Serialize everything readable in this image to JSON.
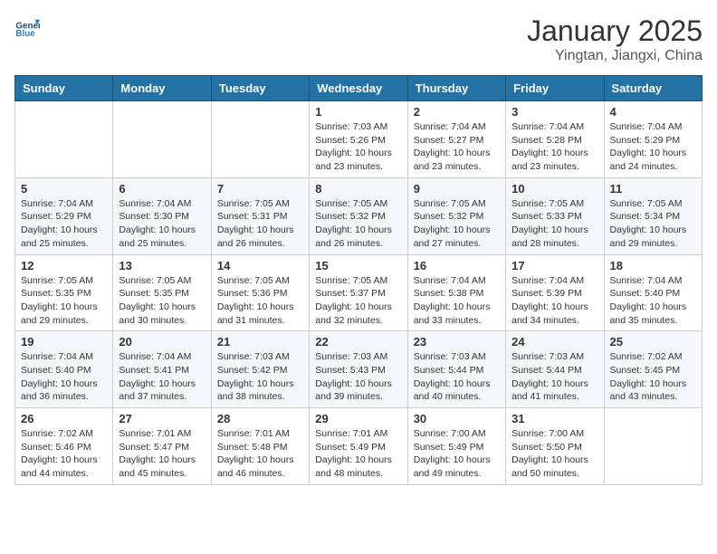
{
  "logo": {
    "line1": "General",
    "line2": "Blue"
  },
  "title": "January 2025",
  "subtitle": "Yingtan, Jiangxi, China",
  "weekdays": [
    "Sunday",
    "Monday",
    "Tuesday",
    "Wednesday",
    "Thursday",
    "Friday",
    "Saturday"
  ],
  "weeks": [
    [
      {
        "day": "",
        "info": ""
      },
      {
        "day": "",
        "info": ""
      },
      {
        "day": "",
        "info": ""
      },
      {
        "day": "1",
        "info": "Sunrise: 7:03 AM\nSunset: 5:26 PM\nDaylight: 10 hours\nand 23 minutes."
      },
      {
        "day": "2",
        "info": "Sunrise: 7:04 AM\nSunset: 5:27 PM\nDaylight: 10 hours\nand 23 minutes."
      },
      {
        "day": "3",
        "info": "Sunrise: 7:04 AM\nSunset: 5:28 PM\nDaylight: 10 hours\nand 23 minutes."
      },
      {
        "day": "4",
        "info": "Sunrise: 7:04 AM\nSunset: 5:29 PM\nDaylight: 10 hours\nand 24 minutes."
      }
    ],
    [
      {
        "day": "5",
        "info": "Sunrise: 7:04 AM\nSunset: 5:29 PM\nDaylight: 10 hours\nand 25 minutes."
      },
      {
        "day": "6",
        "info": "Sunrise: 7:04 AM\nSunset: 5:30 PM\nDaylight: 10 hours\nand 25 minutes."
      },
      {
        "day": "7",
        "info": "Sunrise: 7:05 AM\nSunset: 5:31 PM\nDaylight: 10 hours\nand 26 minutes."
      },
      {
        "day": "8",
        "info": "Sunrise: 7:05 AM\nSunset: 5:32 PM\nDaylight: 10 hours\nand 26 minutes."
      },
      {
        "day": "9",
        "info": "Sunrise: 7:05 AM\nSunset: 5:32 PM\nDaylight: 10 hours\nand 27 minutes."
      },
      {
        "day": "10",
        "info": "Sunrise: 7:05 AM\nSunset: 5:33 PM\nDaylight: 10 hours\nand 28 minutes."
      },
      {
        "day": "11",
        "info": "Sunrise: 7:05 AM\nSunset: 5:34 PM\nDaylight: 10 hours\nand 29 minutes."
      }
    ],
    [
      {
        "day": "12",
        "info": "Sunrise: 7:05 AM\nSunset: 5:35 PM\nDaylight: 10 hours\nand 29 minutes."
      },
      {
        "day": "13",
        "info": "Sunrise: 7:05 AM\nSunset: 5:35 PM\nDaylight: 10 hours\nand 30 minutes."
      },
      {
        "day": "14",
        "info": "Sunrise: 7:05 AM\nSunset: 5:36 PM\nDaylight: 10 hours\nand 31 minutes."
      },
      {
        "day": "15",
        "info": "Sunrise: 7:05 AM\nSunset: 5:37 PM\nDaylight: 10 hours\nand 32 minutes."
      },
      {
        "day": "16",
        "info": "Sunrise: 7:04 AM\nSunset: 5:38 PM\nDaylight: 10 hours\nand 33 minutes."
      },
      {
        "day": "17",
        "info": "Sunrise: 7:04 AM\nSunset: 5:39 PM\nDaylight: 10 hours\nand 34 minutes."
      },
      {
        "day": "18",
        "info": "Sunrise: 7:04 AM\nSunset: 5:40 PM\nDaylight: 10 hours\nand 35 minutes."
      }
    ],
    [
      {
        "day": "19",
        "info": "Sunrise: 7:04 AM\nSunset: 5:40 PM\nDaylight: 10 hours\nand 36 minutes."
      },
      {
        "day": "20",
        "info": "Sunrise: 7:04 AM\nSunset: 5:41 PM\nDaylight: 10 hours\nand 37 minutes."
      },
      {
        "day": "21",
        "info": "Sunrise: 7:03 AM\nSunset: 5:42 PM\nDaylight: 10 hours\nand 38 minutes."
      },
      {
        "day": "22",
        "info": "Sunrise: 7:03 AM\nSunset: 5:43 PM\nDaylight: 10 hours\nand 39 minutes."
      },
      {
        "day": "23",
        "info": "Sunrise: 7:03 AM\nSunset: 5:44 PM\nDaylight: 10 hours\nand 40 minutes."
      },
      {
        "day": "24",
        "info": "Sunrise: 7:03 AM\nSunset: 5:44 PM\nDaylight: 10 hours\nand 41 minutes."
      },
      {
        "day": "25",
        "info": "Sunrise: 7:02 AM\nSunset: 5:45 PM\nDaylight: 10 hours\nand 43 minutes."
      }
    ],
    [
      {
        "day": "26",
        "info": "Sunrise: 7:02 AM\nSunset: 5:46 PM\nDaylight: 10 hours\nand 44 minutes."
      },
      {
        "day": "27",
        "info": "Sunrise: 7:01 AM\nSunset: 5:47 PM\nDaylight: 10 hours\nand 45 minutes."
      },
      {
        "day": "28",
        "info": "Sunrise: 7:01 AM\nSunset: 5:48 PM\nDaylight: 10 hours\nand 46 minutes."
      },
      {
        "day": "29",
        "info": "Sunrise: 7:01 AM\nSunset: 5:49 PM\nDaylight: 10 hours\nand 48 minutes."
      },
      {
        "day": "30",
        "info": "Sunrise: 7:00 AM\nSunset: 5:49 PM\nDaylight: 10 hours\nand 49 minutes."
      },
      {
        "day": "31",
        "info": "Sunrise: 7:00 AM\nSunset: 5:50 PM\nDaylight: 10 hours\nand 50 minutes."
      },
      {
        "day": "",
        "info": ""
      }
    ]
  ]
}
